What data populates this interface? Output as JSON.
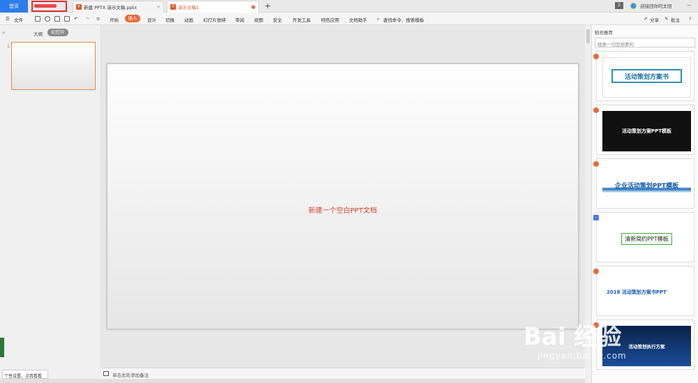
{
  "tabs": {
    "home": "首页",
    "doc1": "新建 PPTX 演示文稿.pptx",
    "doc2": "演示文稿1",
    "account": "迎接回你的太阳",
    "count": "2"
  },
  "menu": {
    "file": "文件",
    "items": [
      "开始",
      "插入",
      "设计",
      "切换",
      "动画",
      "幻灯片放映",
      "审阅",
      "视图",
      "安全",
      "开发工具",
      "特色应用",
      "文档助手"
    ],
    "active": "插入",
    "search": "查找命令、搜索模板",
    "share": "分享",
    "comment": "批注",
    "help": "?"
  },
  "left_panel": {
    "outline_tab": "大纲",
    "slides_tab": "幻灯片",
    "slide_number": "1"
  },
  "slide": {
    "text": "新建一个空白PPT文档"
  },
  "notes": {
    "placeholder": "单击此处添加备注"
  },
  "right_panel": {
    "title": "稻壳推荐",
    "search_placeholder": "搜索一切您想要的",
    "templates": [
      {
        "title": "活动策划方案书"
      },
      {
        "title": "活动策划方案PPT模板"
      },
      {
        "title": "企业活动策划PPT模板"
      },
      {
        "title": "清新简约PPT模板"
      },
      {
        "title": "2018 活动策划方案书PPT"
      },
      {
        "title": "活动策划执行方案"
      }
    ]
  },
  "tooltip": "个性设置，点我看看",
  "watermark": {
    "main": "Bai 经验",
    "sub": "jingyan.baidu.com"
  }
}
